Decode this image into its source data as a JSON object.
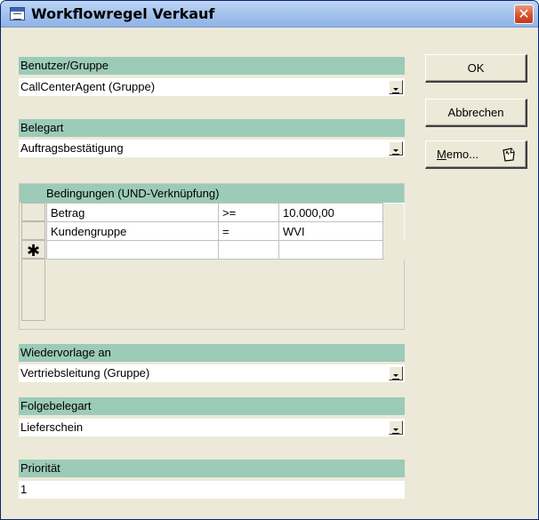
{
  "window": {
    "title": "Workflowregel Verkauf",
    "close_glyph": "✕"
  },
  "buttons": {
    "ok": "OK",
    "cancel": "Abbrechen",
    "memo_u": "M",
    "memo_rest": "emo..."
  },
  "user_group": {
    "label": "Benutzer/Gruppe",
    "value": "CallCenterAgent (Gruppe)"
  },
  "doc_type": {
    "label": "Belegart",
    "value": "Auftragsbestätigung"
  },
  "conditions": {
    "header": "Bedingungen (UND-Verknüpfung)",
    "rows": [
      {
        "field": "Betrag",
        "op": ">=",
        "value": "10.000,00"
      },
      {
        "field": "Kundengruppe",
        "op": "=",
        "value": "WVI"
      },
      {
        "field": "",
        "op": "",
        "value": ""
      }
    ],
    "new_row_marker": "✱"
  },
  "resubmit": {
    "label": "Wiedervorlage an",
    "value": "Vertriebsleitung (Gruppe)"
  },
  "followup": {
    "label": "Folgebelegart",
    "value": "Lieferschein"
  },
  "priority": {
    "label": "Priorität",
    "value": "1"
  },
  "colors": {
    "header_bg": "#9ccbb8",
    "dialog_bg": "#ece9d8",
    "titlebar": "#a6c4ee"
  },
  "icons": [
    "app-icon",
    "close-icon",
    "dropdown-arrow-icon",
    "memo-note-icon"
  ]
}
